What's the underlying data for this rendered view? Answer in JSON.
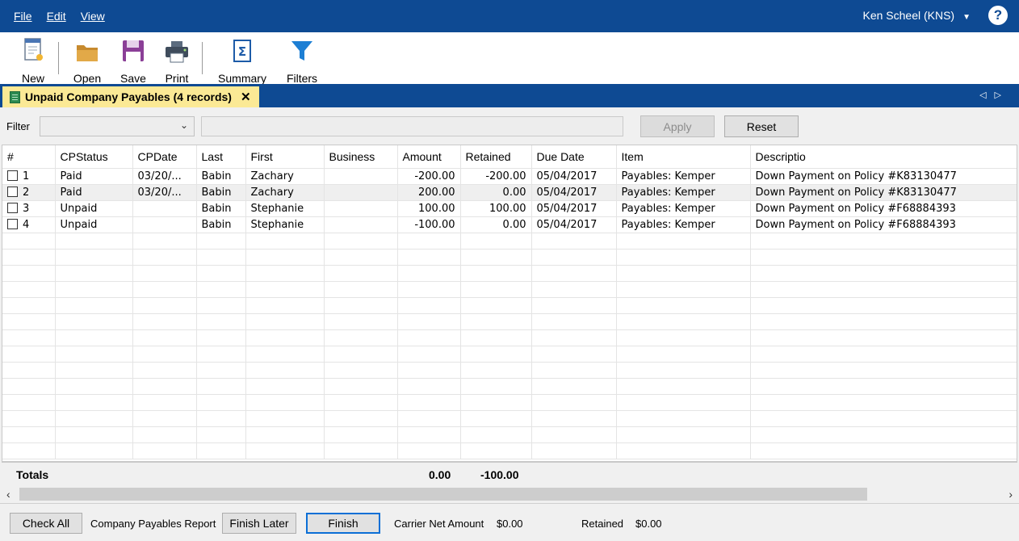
{
  "menu": {
    "items": [
      {
        "label": "File"
      },
      {
        "label": "Edit"
      },
      {
        "label": "View"
      }
    ],
    "user": "Ken Scheel (KNS)",
    "help": "?"
  },
  "toolbar": {
    "new": "New",
    "open": "Open",
    "save": "Save",
    "print": "Print",
    "summary": "Summary",
    "filters": "Filters"
  },
  "tab": {
    "title": "Unpaid Company Payables (4 records)",
    "close": "✕"
  },
  "filter": {
    "label": "Filter",
    "apply": "Apply",
    "reset": "Reset"
  },
  "grid": {
    "columns": [
      "#",
      "CPStatus",
      "CPDate",
      "Last",
      "First",
      "Business",
      "Amount",
      "Retained",
      "Due Date",
      "Item",
      "Descriptio"
    ],
    "rows": [
      {
        "num": "1",
        "status": "Paid",
        "date": "03/20/...",
        "last": "Babin",
        "first": "Zachary",
        "business": "",
        "amount": "-200.00",
        "retained": "-200.00",
        "due": "05/04/2017",
        "item": "Payables: Kemper",
        "desc": "Down Payment on Policy #K83130477"
      },
      {
        "num": "2",
        "status": "Paid",
        "date": "03/20/...",
        "last": "Babin",
        "first": "Zachary",
        "business": "",
        "amount": "200.00",
        "retained": "0.00",
        "due": "05/04/2017",
        "item": "Payables: Kemper",
        "desc": "Down Payment on Policy #K83130477"
      },
      {
        "num": "3",
        "status": "Unpaid",
        "date": "",
        "last": "Babin",
        "first": "Stephanie",
        "business": "",
        "amount": "100.00",
        "retained": "100.00",
        "due": "05/04/2017",
        "item": "Payables: Kemper",
        "desc": "Down Payment on Policy #F68884393"
      },
      {
        "num": "4",
        "status": "Unpaid",
        "date": "",
        "last": "Babin",
        "first": "Stephanie",
        "business": "",
        "amount": "-100.00",
        "retained": "0.00",
        "due": "05/04/2017",
        "item": "Payables: Kemper",
        "desc": "Down Payment on Policy #F68884393"
      }
    ]
  },
  "totals": {
    "label": "Totals",
    "amount": "0.00",
    "retained": "-100.00"
  },
  "footer": {
    "check_all": "Check All",
    "report_label": "Company Payables Report",
    "finish_later": "Finish Later",
    "finish": "Finish",
    "carrier_net_label": "Carrier Net Amount",
    "carrier_net_value": "$0.00",
    "retained_label": "Retained",
    "retained_value": "$0.00"
  },
  "colors": {
    "brand": "#0e4a93",
    "tab_active": "#fbe995",
    "summary_icon": "#1d5ba8",
    "filter_icon": "#1d7fd4",
    "save_icon": "#8b3f97"
  }
}
